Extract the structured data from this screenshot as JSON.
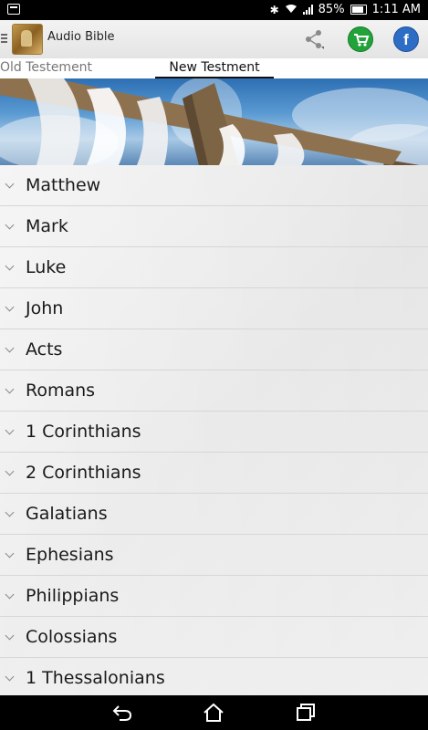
{
  "status_bar": {
    "battery_percent": "85%",
    "time": "1:11 AM",
    "icons": [
      "screenshot-icon",
      "bluetooth-icon",
      "wifi-icon",
      "signal-icon",
      "battery-icon"
    ]
  },
  "app_bar": {
    "title": "Audio Bible",
    "icons": [
      "menu-icon",
      "app-logo",
      "share-icon",
      "shopping-cart-icon",
      "facebook-icon"
    ]
  },
  "tabs": [
    {
      "label": "Old Testement",
      "selected": false
    },
    {
      "label": "New Testment",
      "selected": true
    }
  ],
  "books": [
    "Matthew",
    "Mark",
    "Luke",
    "John",
    "Acts",
    "Romans",
    "1 Corinthians",
    "2 Corinthians",
    "Galatians",
    "Ephesians",
    "Philippians",
    "Colossians",
    "1 Thessalonians"
  ],
  "nav_bar": {
    "icons": [
      "back-icon",
      "home-icon",
      "recent-apps-icon"
    ]
  },
  "colors": {
    "cart_green": "#21a33a",
    "facebook_blue": "#2d6dc6",
    "list_background": "#ececec"
  }
}
